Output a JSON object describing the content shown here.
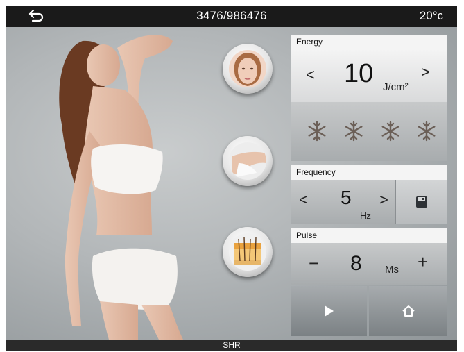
{
  "topbar": {
    "counter": "3476/986476",
    "temperature": "20°c"
  },
  "bottombar": {
    "mode": "SHR"
  },
  "treatment_areas": [
    {
      "name": "face"
    },
    {
      "name": "arm"
    },
    {
      "name": "skin-hair"
    }
  ],
  "energy": {
    "label": "Energy",
    "value": "10",
    "unit": "J/cm²",
    "dec": "<",
    "inc": ">",
    "cooling_levels": 4
  },
  "frequency": {
    "label": "Frequency",
    "value": "5",
    "unit": "Hz",
    "dec": "<",
    "inc": ">"
  },
  "pulse": {
    "label": "Pulse",
    "value": "8",
    "unit": "Ms",
    "dec": "−",
    "inc": "+"
  },
  "icons": {
    "back": "back-arrow-icon",
    "save": "floppy-disk-icon",
    "play": "play-icon",
    "home": "home-icon",
    "snow": "snowflake-icon"
  },
  "colors": {
    "topbar": "#1a1a1a",
    "panel_header": "#f4f4f4"
  }
}
